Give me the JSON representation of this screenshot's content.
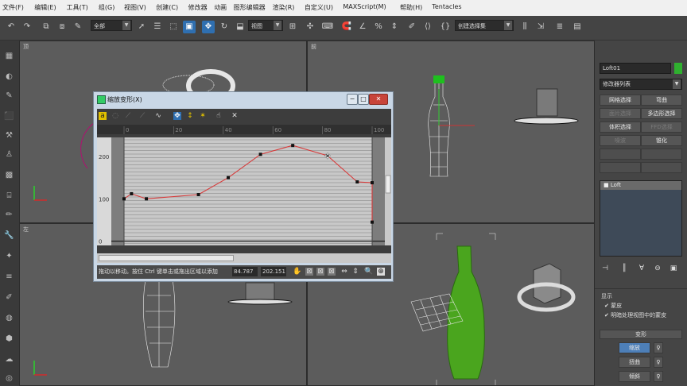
{
  "menu": [
    "文件(F)",
    "编辑(E)",
    "工具(T)",
    "组(G)",
    "视图(V)",
    "创建(C)",
    "修改器",
    "动画",
    "图形编辑器",
    "渲染(R)",
    "自定义(U)",
    "MAXScript(M)",
    "帮助(H)",
    "Tentacles"
  ],
  "toolbar": {
    "selection_filter": "全部",
    "ref_coord": "视图",
    "named_selection": "创建选择集"
  },
  "viewports": {
    "top": "顶",
    "front": "前",
    "left": "左",
    "perspective": ""
  },
  "scale_dialog": {
    "title": "缩放变形(X)",
    "ruler_labels": [
      "0",
      "20",
      "40",
      "60",
      "80",
      "100"
    ],
    "y_labels": [
      "200",
      "100",
      "0"
    ],
    "status_text": "拖动以移动。按住 Ctrl 键单击或拖出区域以添加",
    "x_value": "84.787",
    "y_value": "202.151"
  },
  "chart_data": {
    "type": "line",
    "title": "",
    "xlabel": "",
    "ylabel": "",
    "xlim": [
      0,
      100
    ],
    "ylim": [
      -10,
      245
    ],
    "x": [
      0,
      3,
      9,
      30,
      42,
      55,
      68,
      82,
      94,
      100,
      100
    ],
    "values": [
      100,
      112,
      100,
      110,
      150,
      205,
      226,
      202,
      140,
      138,
      45
    ],
    "color": "#d83a3a"
  },
  "command_panel": {
    "object_name": "Loft01",
    "object_color": "#2fb02f",
    "modifier_list": "修改器列表",
    "buttons": [
      {
        "label": "网格选择",
        "enabled": true
      },
      {
        "label": "弯曲",
        "enabled": true
      },
      {
        "label": "面片选择",
        "enabled": false
      },
      {
        "label": "多边形选择",
        "enabled": true
      },
      {
        "label": "体积选择",
        "enabled": true
      },
      {
        "label": "FFD选择",
        "enabled": false
      },
      {
        "label": "噪波",
        "enabled": false
      },
      {
        "label": "锥化",
        "enabled": true
      }
    ],
    "stack_item": "Loft",
    "display_header": "显示",
    "check_skin": "蒙皮",
    "check_skin_shaded": "明暗处理视图中的蒙皮",
    "deform_header": "变形",
    "deform_items": [
      "缩放",
      "扭曲",
      "倾斜"
    ]
  }
}
